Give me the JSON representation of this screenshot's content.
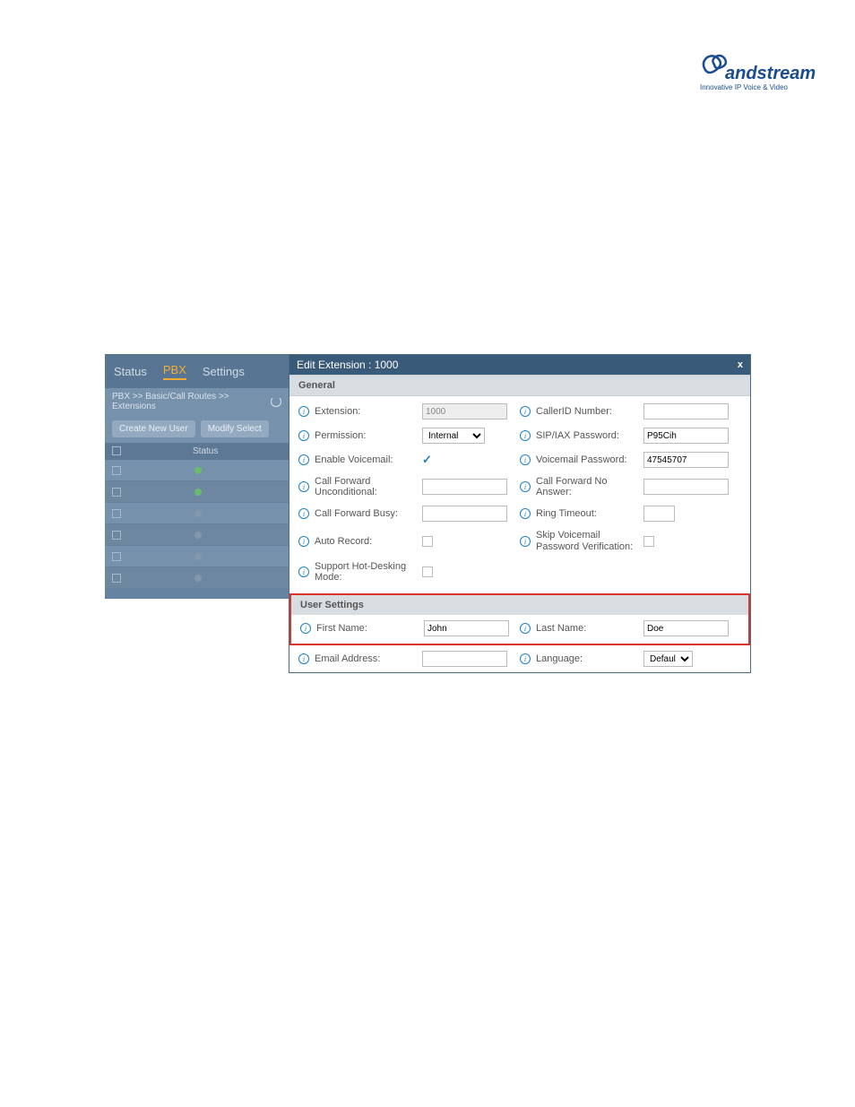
{
  "logo": {
    "brand": "Grandstream",
    "tagline": "Innovative IP Voice & Video"
  },
  "backdrop": {
    "tabs": {
      "status": "Status",
      "pbx": "PBX",
      "settings": "Settings"
    },
    "breadcrumb": "PBX >> Basic/Call Routes >> Extensions",
    "buttons": {
      "create": "Create New User",
      "modify": "Modify Select"
    },
    "table_header": {
      "status": "Status"
    }
  },
  "modal": {
    "title": "Edit Extension : 1000",
    "sections": {
      "general": "General",
      "user_settings": "User Settings"
    },
    "fields": {
      "extension": {
        "label": "Extension:",
        "value": "1000"
      },
      "callerid": {
        "label": "CallerID Number:",
        "value": ""
      },
      "permission": {
        "label": "Permission:",
        "value": "Internal"
      },
      "sipiax_pw": {
        "label": "SIP/IAX Password:",
        "value": "P95Cih"
      },
      "enable_vm": {
        "label": "Enable Voicemail:"
      },
      "vm_pw": {
        "label": "Voicemail Password:",
        "value": "47545707"
      },
      "cf_uncond": {
        "label": "Call Forward Unconditional:",
        "value": ""
      },
      "cf_noans": {
        "label": "Call Forward No Answer:",
        "value": ""
      },
      "cf_busy": {
        "label": "Call Forward Busy:",
        "value": ""
      },
      "ring_timeout": {
        "label": "Ring Timeout:",
        "value": ""
      },
      "auto_record": {
        "label": "Auto Record:"
      },
      "skip_vm_verify": {
        "label": "Skip Voicemail Password Verification:"
      },
      "hot_desk": {
        "label": "Support Hot-Desking Mode:"
      },
      "first_name": {
        "label": "First Name:",
        "value": "John"
      },
      "last_name": {
        "label": "Last Name:",
        "value": "Doe"
      },
      "email": {
        "label": "Email Address:",
        "value": ""
      },
      "language": {
        "label": "Language:",
        "value": "Default"
      }
    }
  }
}
